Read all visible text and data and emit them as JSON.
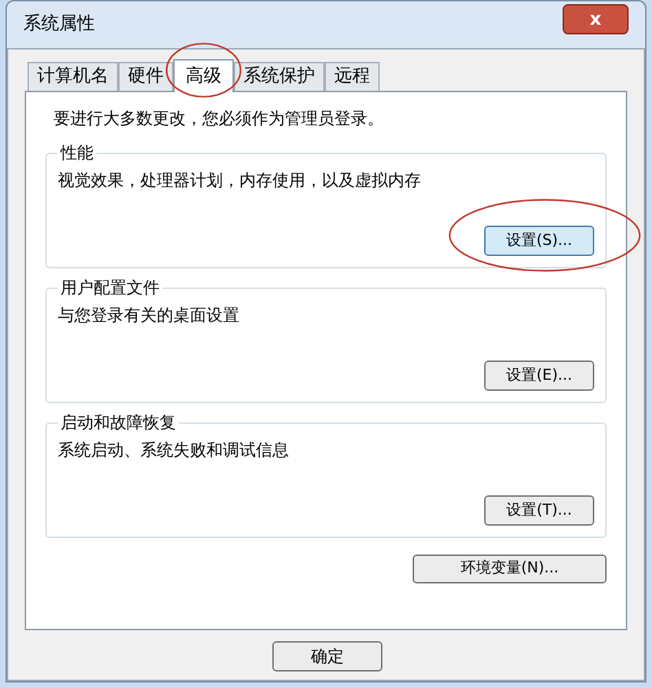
{
  "window": {
    "title": "系统属性",
    "close": "x"
  },
  "tabs": [
    {
      "label": "计算机名",
      "selected": false,
      "circled": false
    },
    {
      "label": "硬件",
      "selected": false,
      "circled": false
    },
    {
      "label": "高级",
      "selected": true,
      "circled": true
    },
    {
      "label": "系统保护",
      "selected": false,
      "circled": false
    },
    {
      "label": "远程",
      "selected": false,
      "circled": false
    }
  ],
  "notice": "要进行大多数更改，您必须作为管理员登录。",
  "groups": [
    {
      "title": "性能",
      "description": "视觉效果，处理器计划，内存使用，以及虚拟内存",
      "button": {
        "label": "设置(S)...",
        "focused": true,
        "circled": true
      }
    },
    {
      "title": "用户配置文件",
      "description": "与您登录有关的桌面设置",
      "button": {
        "label": "设置(E)...",
        "focused": false,
        "circled": false
      }
    },
    {
      "title": "启动和故障恢复",
      "description": "系统启动、系统失败和调试信息",
      "button": {
        "label": "设置(T)...",
        "focused": false,
        "circled": false
      }
    }
  ],
  "env_button": {
    "label": "环境变量(N)..."
  },
  "dialog_buttons": [
    "确定"
  ]
}
